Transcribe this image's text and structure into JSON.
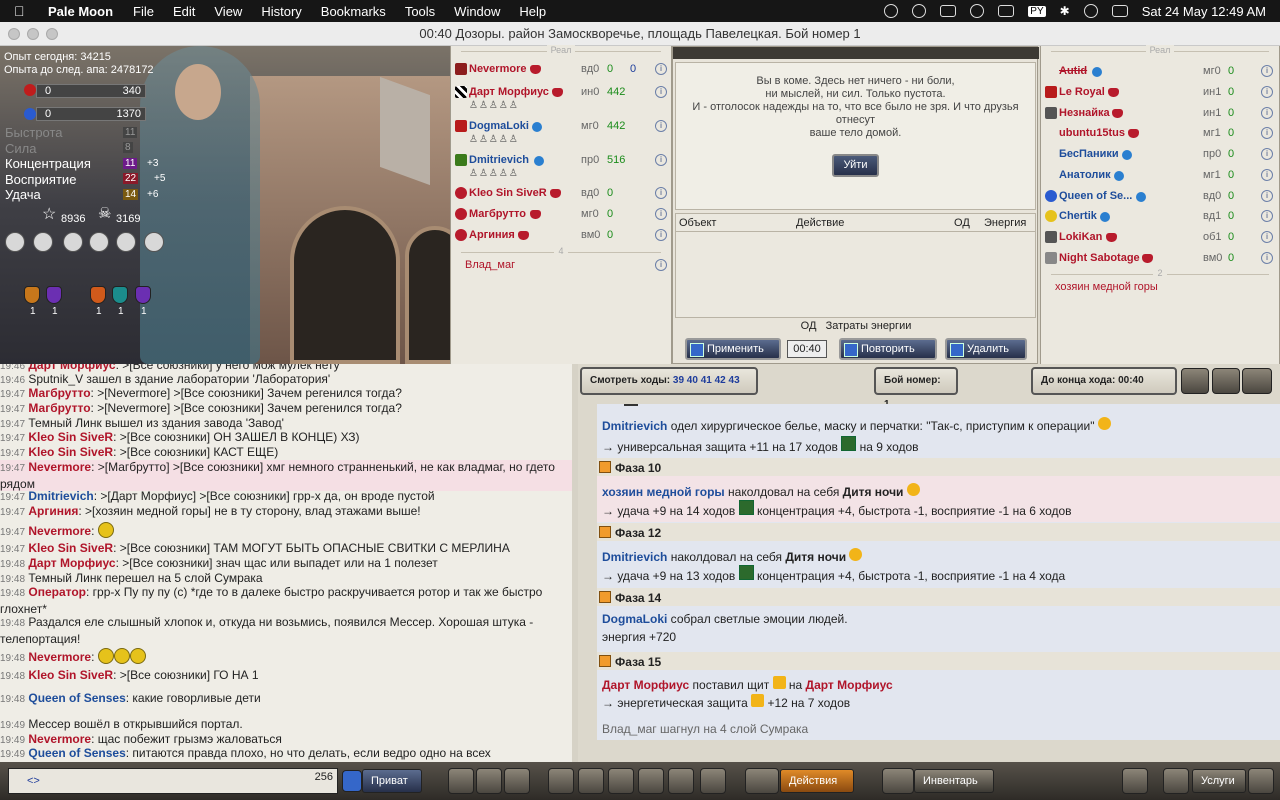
{
  "menubar": {
    "app": "Pale Moon",
    "items": [
      "File",
      "Edit",
      "View",
      "History",
      "Bookmarks",
      "Tools",
      "Window",
      "Help"
    ],
    "lang": "PY",
    "clock": "Sat 24 May  12:49 AM"
  },
  "window_title": "00:40 Дозоры. район Замоскворечье, площадь Павелецкая. Бой номер 1",
  "player": {
    "exp_today": "Опыт сегодня: 34215",
    "exp_next": "Опыта до след. апа: 2478172",
    "hp": {
      "left": "0",
      "right": "340"
    },
    "mp": {
      "left": "0",
      "right": "1370"
    },
    "stats": [
      {
        "label": "Быстрота",
        "value": "11",
        "bonus": ""
      },
      {
        "label": "Сила",
        "value": "8",
        "bonus": ""
      },
      {
        "label": "Концентрация",
        "value": "11",
        "bonus": "+3"
      },
      {
        "label": "Восприятие",
        "value": "22",
        "bonus": "+5"
      },
      {
        "label": "Удача",
        "value": "14",
        "bonus": "+6"
      }
    ],
    "stars": "8936",
    "skulls": "3169",
    "badge_counts": [
      "1",
      "1",
      "1",
      "1",
      "1"
    ]
  },
  "team_left": {
    "header": "Реал",
    "members": [
      {
        "name": "Nevermore",
        "skill": "вд0",
        "v1": "0",
        "v2": "0"
      },
      {
        "name": "Дарт Морфиус",
        "skill": "ин0",
        "v1": "442",
        "v2": ""
      },
      {
        "name": "DogmaLoki",
        "skill": "мг0",
        "v1": "442",
        "v2": ""
      },
      {
        "name": "Dmitrievich",
        "skill": "пр0",
        "v1": "516",
        "v2": ""
      },
      {
        "name": "Kleo Sin SiveR",
        "skill": "вд0",
        "v1": "0",
        "v2": ""
      },
      {
        "name": "Магбрутто",
        "skill": "мг0",
        "v1": "0",
        "v2": ""
      },
      {
        "name": "Аргиния",
        "skill": "вм0",
        "v1": "0",
        "v2": ""
      }
    ],
    "divider": "4",
    "ghost": "Влад_маг"
  },
  "team_right": {
    "header": "Реал",
    "members": [
      {
        "name": "Autid",
        "skill": "мг0",
        "v1": "0"
      },
      {
        "name": "Le Royal",
        "skill": "ин1",
        "v1": "0"
      },
      {
        "name": "Незнайка",
        "skill": "ин1",
        "v1": "0"
      },
      {
        "name": "ubuntu15tus",
        "skill": "мг1",
        "v1": "0"
      },
      {
        "name": "БесПаники",
        "skill": "пр0",
        "v1": "0"
      },
      {
        "name": "Анатолик",
        "skill": "мг1",
        "v1": "0"
      },
      {
        "name": "Queen of Se...",
        "skill": "вд0",
        "v1": "0"
      },
      {
        "name": "Chertik",
        "skill": "вд1",
        "v1": "0"
      },
      {
        "name": "LokiKan",
        "skill": "об1",
        "v1": "0"
      },
      {
        "name": "Night Sabotage",
        "skill": "вм0",
        "v1": "0"
      }
    ],
    "divider": "2",
    "ghost": "хозяин медной горы"
  },
  "coma": {
    "line1": "Вы в коме. Здесь нет ничего - ни боли,",
    "line2": "ни мыслей, ни сил. Только пустота.",
    "line3": "И - отголосок надежды на то, что все было не зря. И что друзья отнесут",
    "line4": "ваше тело домой.",
    "button": "Уйти"
  },
  "actions_table": {
    "col_object": "Объект",
    "col_action": "Действие",
    "col_od": "ОД",
    "col_energy": "Энергия"
  },
  "cost_row": {
    "od": "ОД",
    "energy": "Затраты энергии"
  },
  "buttons": {
    "apply": "Применить",
    "timer": "00:40",
    "repeat": "Повторить",
    "delete": "Удалить"
  },
  "chat": [
    {
      "t": "19:46",
      "n": "Дарт Морфиус",
      "msg": ": >[Все союзники]  у него мож мулек нету"
    },
    {
      "t": "19:46",
      "sys": "Sputnik_V зашел в здание лаборатории 'Лаборатория'"
    },
    {
      "t": "19:47",
      "n": "Магбрутто",
      "msg": ": >[Nevermore] >[Все союзники]  Зачем регенился тогда?"
    },
    {
      "t": "19:47",
      "n": "Магбрутто",
      "msg": ": >[Nevermore] >[Все союзники]  Зачем регенился тогда?"
    },
    {
      "t": "19:47",
      "sys": "Темный Линк вышел из здания завода 'Завод'"
    },
    {
      "t": "19:47",
      "n": "Kleo Sin SiveR",
      "msg": ": >[Все союзники]  ОН ЗАШЕЛ В КОНЦЕ) ХЗ)"
    },
    {
      "t": "19:47",
      "n": "Kleo Sin SiveR",
      "msg": ": >[Все союзники]  КАСТ ЕЩЕ)"
    },
    {
      "t": "19:47",
      "n": "Nevermore",
      "msg": ": >[Магбрутто] >[Все союзники]  хмг немного странненький, не как владмаг, но гдето рядом"
    },
    {
      "t": "19:47",
      "n": "Dmitrievich",
      "msg": ": >[Дарт Морфиус] >[Все союзники]  грр-х да, он вроде пустой"
    },
    {
      "t": "19:47",
      "n": "Аргиния",
      "msg": ": >[хозяин медной горы]  не в ту сторону, влад этажами выше!"
    },
    {
      "t": "19:47",
      "n": "Nevermore",
      "msg": ":"
    },
    {
      "t": "19:47",
      "n": "Kleo Sin SiveR",
      "msg": ": >[Все союзники]  ТАМ МОГУТ БЫТЬ ОПАСНЫЕ СВИТКИ С МЕРЛИНА"
    },
    {
      "t": "19:48",
      "n": "Дарт Морфиус",
      "msg": ": >[Все союзники]  знач щас или выпадет или на 1 полезет"
    },
    {
      "t": "19:48",
      "sys": "Темный Линк перешел на 5 слой Сумрака"
    },
    {
      "t": "19:48",
      "n": "Оператор",
      "msg": ":  грр-х Пу пу пу (c) *где то в далеке быстро раскручивается ротор и так же быстро глохнет*"
    },
    {
      "t": "19:48",
      "sys": "Раздался еле слышный хлопок и, откуда ни возьмись, появился Мессер. Хорошая штука - телепортация!"
    },
    {
      "t": "19:48",
      "n": "Nevermore",
      "msg": ":"
    },
    {
      "t": "19:48",
      "n": "Kleo Sin SiveR",
      "msg": ": >[Все союзники]  ГО НА 1"
    },
    {
      "t": "19:48",
      "n": "Queen of Senses",
      "msg": ":     какие говорливые дети"
    },
    {
      "t": "19:49",
      "sys": "Мессер вошёл в открывшийся портал."
    },
    {
      "t": "19:49",
      "n": "Nevermore",
      "msg": ":  щас побежит грызмэ жаловаться"
    },
    {
      "t": "19:49",
      "n": "Queen of Senses",
      "msg": ":  питаются правда плохо, но что делать, если ведро одно на всех"
    }
  ],
  "log_top": {
    "moves_label": "Смотреть ходы:",
    "moves": "39 40 41 42 43",
    "battle": "Бой номер: 1",
    "turn_end": "До конца хода: 00:40"
  },
  "log": {
    "e1_name": "Dmitrievich",
    "e1_text": " одел хирургическое белье, маску и перчатки: \"Так-с, приступим к операции\"",
    "e1_sub": "→ универсальная защита +11 на 17 ходов",
    "e1_sub2": "на 9 ходов",
    "p10": "Фаза 10",
    "e2_name": "хозяин медной горы",
    "e2_text": " наколдовал на себя ",
    "e2_spell": "Дитя ночи",
    "e2_sub": "→  удача +9 на 14 ходов",
    "e2_sub2": "концентрация +4, быстрота -1, восприятие -1 на 6 ходов",
    "p12": "Фаза 12",
    "e3_name": "Dmitrievich",
    "e3_text": " наколдовал на себя ",
    "e3_spell": "Дитя ночи",
    "e3_sub": "→  удача +9 на 13 ходов",
    "e3_sub2": "концентрация +4, быстрота -1, восприятие -1 на 4 хода",
    "p14": "Фаза 14",
    "e4_name": "DogmaLoki",
    "e4_text": " собрал светлые эмоции людей.",
    "e4_sub": "энергия +720",
    "p15": "Фаза 15",
    "e5_name": "Дарт Морфиус",
    "e5_text": " поставил щит",
    "e5_mid": " на ",
    "e5_target": "Дарт Морфиус",
    "e5_sub": "→ энергетическая защита",
    "e5_sub2": "+12 на 7 ходов",
    "e6": "Влад_маг шагнул на 4 слой Сумрака"
  },
  "inputbar": {
    "prefix": "<>",
    "count": "256",
    "private": "Приват",
    "actions": "Действия",
    "inventory": "Инвентарь",
    "services": "Услуги"
  }
}
